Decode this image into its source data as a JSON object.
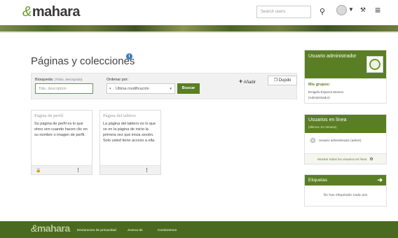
{
  "header": {
    "logo_text": "mahara",
    "logo_amp": "&",
    "search_placeholder": "Search users",
    "search_icon": "search-icon",
    "chevron": "v",
    "user_icon": "wrench-icon",
    "menu_icon": "hamburger-menu-icon"
  },
  "main": {
    "title": "Páginas y colecciones",
    "info_icon": "i",
    "filter": {
      "search_label": "Búsqueda:",
      "search_hint": "(Título, descripción)",
      "search_placeholder": "Title, description",
      "order_label": "Ordenar por:",
      "order_value": "Última modificación",
      "search_button": "Buscar",
      "add_button": "Añadir",
      "duplicate_button": "Dupdo"
    },
    "cards": [
      {
        "title": "Página de perfil",
        "description": "Su página de perfil es lo que otros ven cuando hacen clic en su nombre o imagen de perfil."
      },
      {
        "title": "Página del tablero",
        "description": "La página del tablero es lo que ve en la página de inicio la primera vez que inicia sesión. Solo usted tiene acceso a ella."
      }
    ]
  },
  "sidebar": {
    "user_block": {
      "title": "Usuario administrador",
      "groups_label": "Mis grupos:",
      "group_name": "Emigdio Esparza Moreno",
      "group_role": "(Administrador)"
    },
    "online_block": {
      "title": "Usuarios en línea",
      "subtitle": "(últimos 10 minutos)",
      "user": "Usuario administrador (admin)",
      "show_all": "Mostrar todos los usuarios en línea"
    },
    "tags_block": {
      "title": "Etiquetas",
      "empty": "No has etiquetado nada aún"
    }
  },
  "footer": {
    "logo_text": "mahara",
    "links": [
      "Declaracion de privacidad",
      "Acerca de",
      "Contáctenos"
    ]
  },
  "colors": {
    "accent": "#5a7e24",
    "footer": "#4a6a20",
    "info": "#3b7bbf"
  }
}
